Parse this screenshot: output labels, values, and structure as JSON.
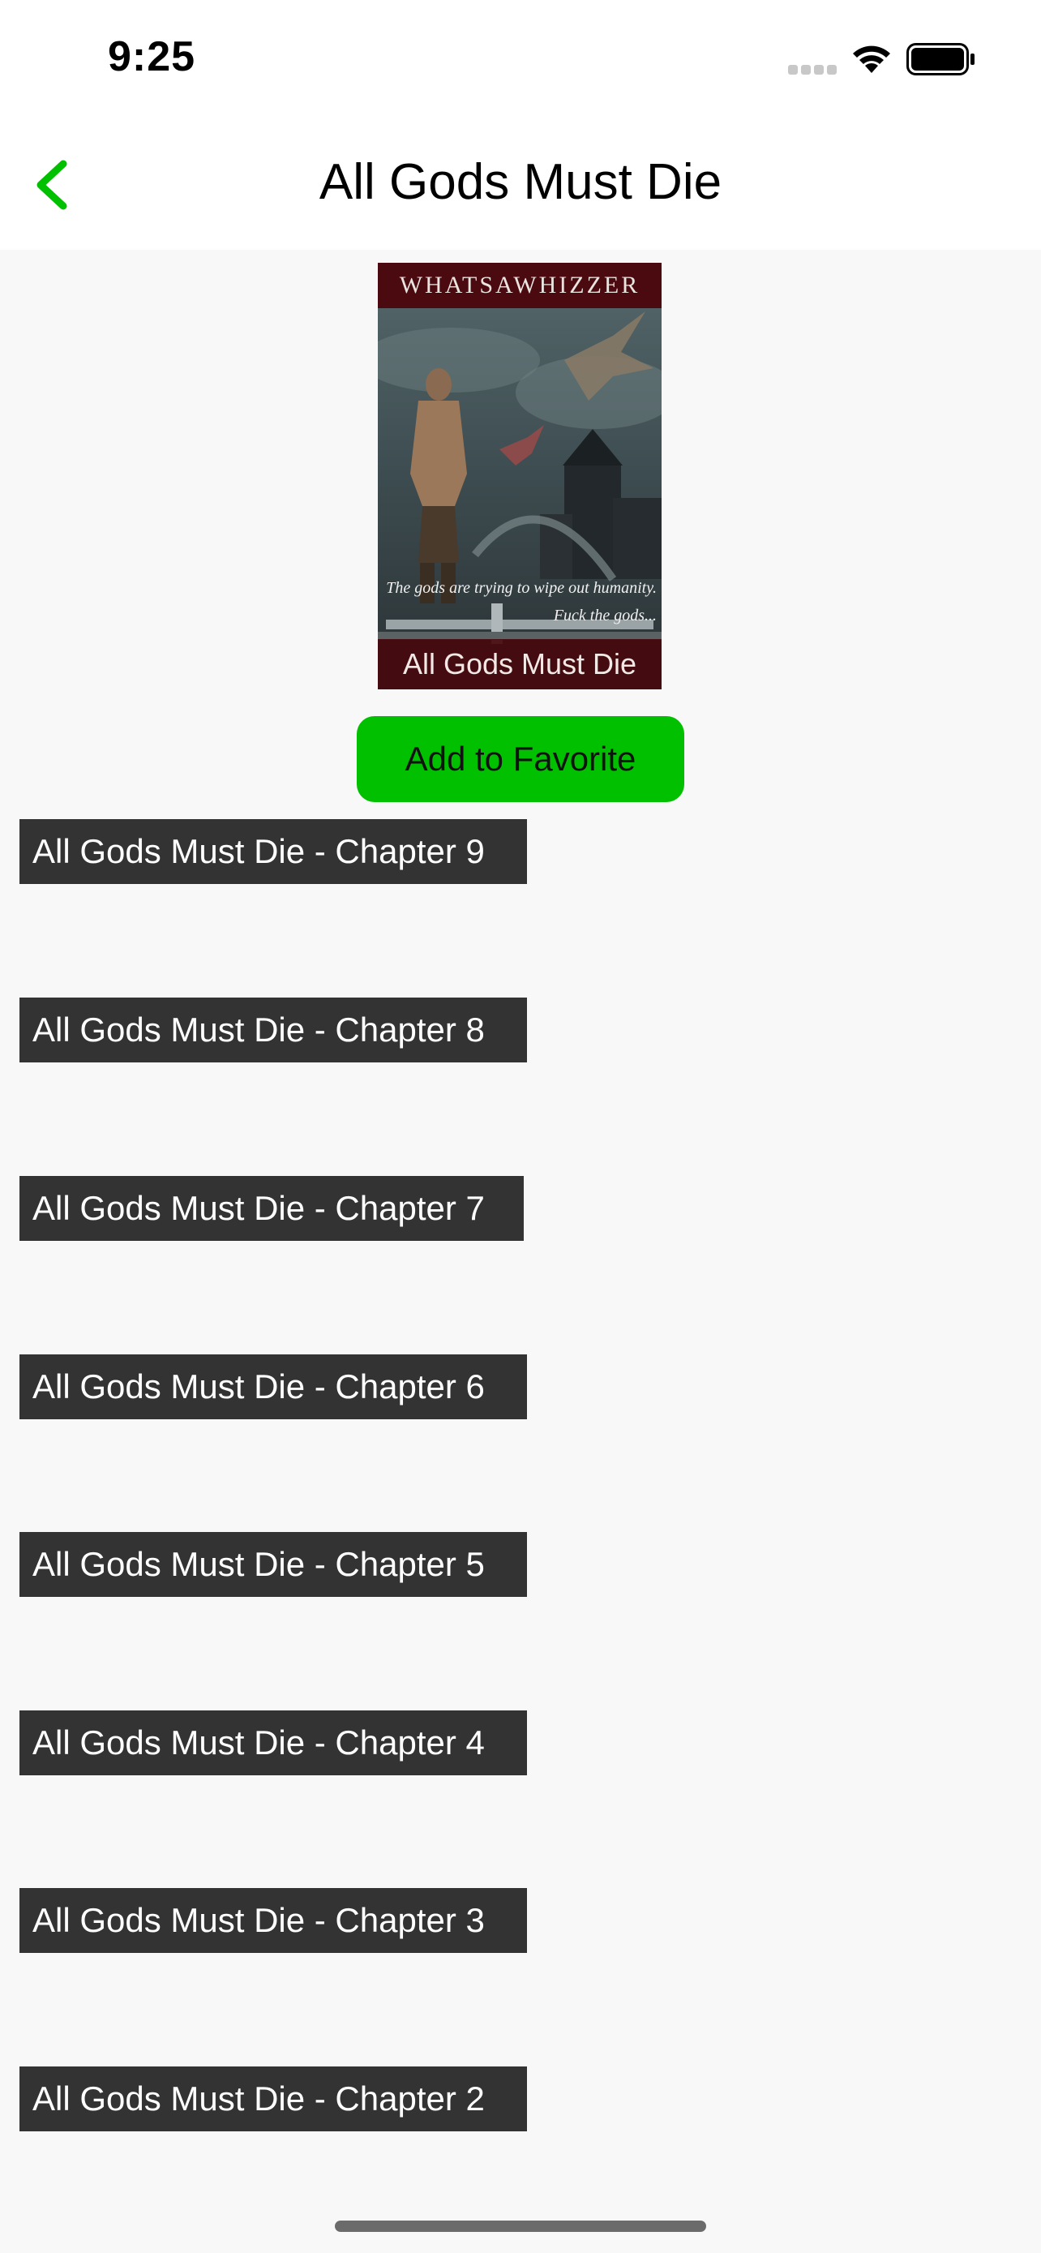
{
  "status_bar": {
    "time": "9:25"
  },
  "nav": {
    "title": "All Gods Must Die",
    "back_icon": "chevron-left-icon",
    "accent_color": "#00c000"
  },
  "cover": {
    "author": "WHATSAWHIZZER",
    "tagline": "The gods are trying to wipe out humanity.\nFuck the gods...",
    "title": "All Gods Must Die"
  },
  "favorite_button": {
    "label": "Add to Favorite",
    "color": "#00c000"
  },
  "chapters": [
    "All Gods Must Die - Chapter 9",
    "All Gods Must Die - Chapter 8",
    "All Gods Must Die - Chapter 7",
    "All Gods Must Die - Chapter 6",
    "All Gods Must Die - Chapter 5",
    "All Gods Must Die - Chapter 4",
    "All Gods Must Die - Chapter 3",
    "All Gods Must Die - Chapter 2"
  ]
}
